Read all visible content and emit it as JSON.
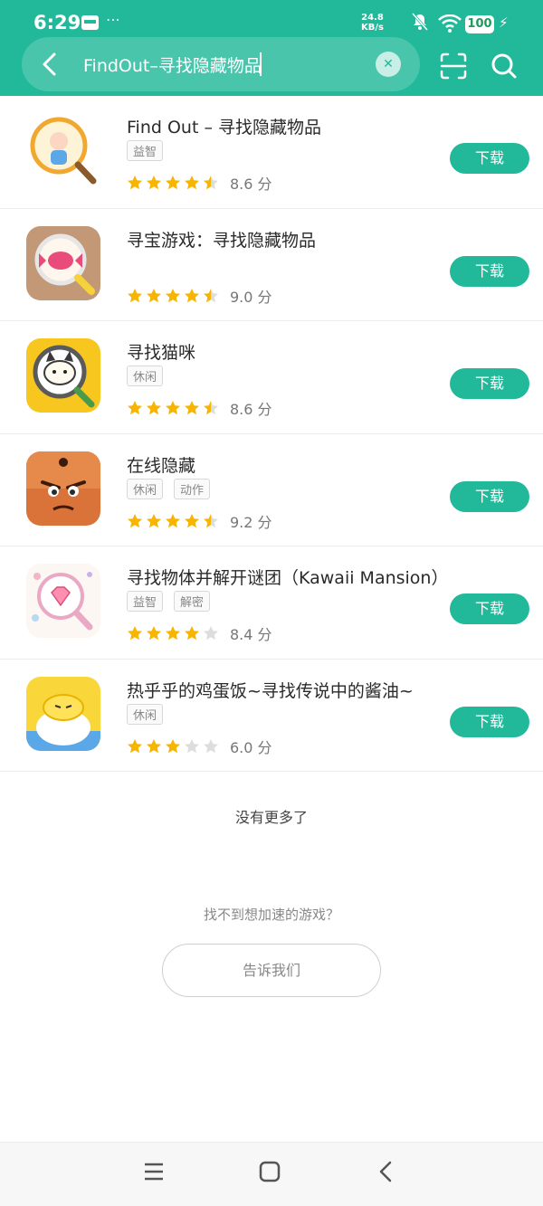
{
  "status_bar": {
    "time": "6:29",
    "net_speed_value": "24.8",
    "net_speed_unit": "KB/s",
    "battery": "100"
  },
  "search": {
    "query": "FindOut–寻找隐藏物品"
  },
  "apps": [
    {
      "name": "Find Out – 寻找隐藏物品",
      "tags": [
        "益智"
      ],
      "stars": 4.5,
      "score": "8.6 分",
      "button": "下载"
    },
    {
      "name": "寻宝游戏：寻找隐藏物品",
      "tags": [],
      "stars": 4.5,
      "score": "9.0 分",
      "button": "下载"
    },
    {
      "name": "寻找猫咪",
      "tags": [
        "休闲"
      ],
      "stars": 4.5,
      "score": "8.6 分",
      "button": "下载"
    },
    {
      "name": "在线隐藏",
      "tags": [
        "休闲",
        "动作"
      ],
      "stars": 4.5,
      "score": "9.2 分",
      "button": "下载"
    },
    {
      "name": "寻找物体并解开谜团（Kawaii Mansion）",
      "tags": [
        "益智",
        "解密"
      ],
      "stars": 4,
      "score": "8.4 分",
      "button": "下载"
    },
    {
      "name": "热乎乎的鸡蛋饭~寻找传说中的酱油~",
      "tags": [
        "休闲"
      ],
      "stars": 3,
      "score": "6.0 分",
      "button": "下载"
    }
  ],
  "footer": {
    "no_more": "没有更多了",
    "not_found_text": "找不到想加速的游戏？",
    "tell_us_button": "告诉我们"
  },
  "colors": {
    "accent": "#22b99a",
    "star": "#f7b500",
    "star_empty": "#dddddd"
  },
  "icons": {
    "back": "back-arrow-icon",
    "clear": "clear-icon",
    "scan": "scan-icon",
    "search": "search-icon",
    "nav_menu": "menu-icon",
    "nav_home": "home-icon",
    "nav_back": "nav-back-icon"
  }
}
